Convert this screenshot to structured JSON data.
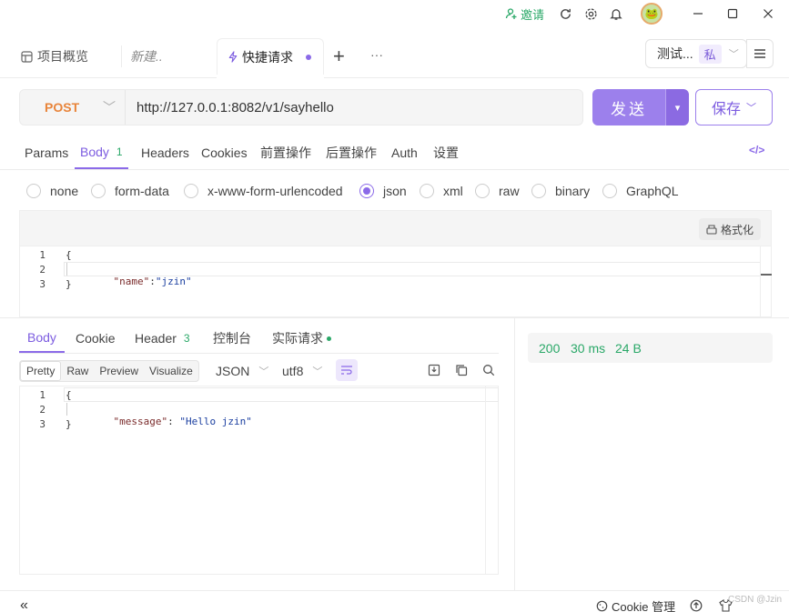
{
  "titlebar": {
    "invite_label": "邀请",
    "icons": [
      "user-add-icon",
      "sync-icon",
      "gear-icon",
      "bell-icon",
      "avatar",
      "minimize-icon",
      "maximize-icon",
      "close-icon"
    ]
  },
  "tabs": {
    "items": [
      {
        "label": "项目概览",
        "icon": "overview-icon"
      },
      {
        "label": "新建..",
        "italic": true
      },
      {
        "label": "快捷请求",
        "icon": "lightning-icon",
        "active": true,
        "unsaved": true
      }
    ],
    "add_label": "+",
    "more_label": "···"
  },
  "environment": {
    "label": "测试...",
    "badge": "私"
  },
  "request": {
    "method": "POST",
    "url": "http://127.0.0.1:8082/v1/sayhello",
    "send_label": "发送",
    "save_label": "保存"
  },
  "request_tabs": [
    {
      "label": "Params"
    },
    {
      "label": "Body",
      "count": "1",
      "active": true
    },
    {
      "label": "Headers"
    },
    {
      "label": "Cookies"
    },
    {
      "label": "前置操作"
    },
    {
      "label": "后置操作"
    },
    {
      "label": "Auth"
    },
    {
      "label": "设置"
    }
  ],
  "code_toggle": "</>",
  "body_types": [
    {
      "label": "none"
    },
    {
      "label": "form-data"
    },
    {
      "label": "x-www-form-urlencoded"
    },
    {
      "label": "json",
      "selected": true
    },
    {
      "label": "xml"
    },
    {
      "label": "raw"
    },
    {
      "label": "binary"
    },
    {
      "label": "GraphQL"
    }
  ],
  "format_label": "格式化",
  "request_body": {
    "lines": [
      "1",
      "2",
      "3"
    ],
    "open": "{",
    "key": "\"name\"",
    "colon": ":",
    "value": "\"jzin\"",
    "close": "}"
  },
  "response_tabs": [
    {
      "label": "Body",
      "active": true
    },
    {
      "label": "Cookie"
    },
    {
      "label": "Header",
      "count": "3"
    },
    {
      "label": "控制台"
    },
    {
      "label": "实际请求",
      "dot": true
    }
  ],
  "view_modes": [
    "Pretty",
    "Raw",
    "Preview",
    "Visualize"
  ],
  "response_format": "JSON",
  "response_encoding": "utf8",
  "response_body": {
    "lines": [
      "1",
      "2",
      "3"
    ],
    "open": "{",
    "key": "\"message\"",
    "colon": ": ",
    "value": "\"Hello jzin\"",
    "close": "}"
  },
  "status": {
    "code": "200",
    "time": "30 ms",
    "size": "24 B"
  },
  "footer": {
    "collapse_label": "«",
    "cookie_label": "Cookie 管理",
    "watermark": "CSDN @Jzin"
  }
}
